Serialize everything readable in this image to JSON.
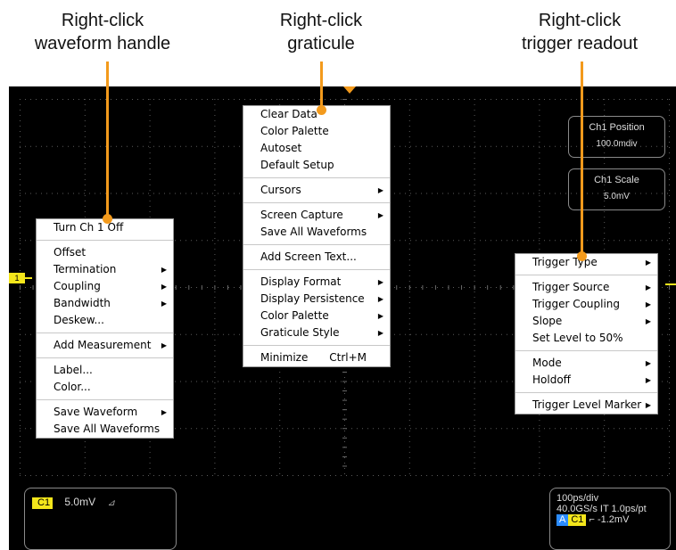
{
  "captions": [
    {
      "line1": "Right-click",
      "line2": "waveform handle"
    },
    {
      "line1": "Right-click",
      "line2": "graticule"
    },
    {
      "line1": "Right-click",
      "line2": "trigger readout"
    }
  ],
  "waveform_menu": {
    "items": [
      {
        "label": "Turn Ch 1 Off",
        "sep_after": true
      },
      {
        "label": "Offset"
      },
      {
        "label": "Termination",
        "submenu": true
      },
      {
        "label": "Coupling",
        "submenu": true
      },
      {
        "label": "Bandwidth",
        "submenu": true
      },
      {
        "label": "Deskew...",
        "sep_after": true
      },
      {
        "label": "Add Measurement",
        "submenu": true,
        "sep_after": true
      },
      {
        "label": "Label..."
      },
      {
        "label": "Color...",
        "sep_after": true
      },
      {
        "label": "Save Waveform",
        "submenu": true
      },
      {
        "label": "Save All Waveforms"
      }
    ]
  },
  "graticule_menu": {
    "items": [
      {
        "label": "Clear Data"
      },
      {
        "label": "Color Palette"
      },
      {
        "label": "Autoset"
      },
      {
        "label": "Default Setup",
        "sep_after": true
      },
      {
        "label": "Cursors",
        "submenu": true,
        "sep_after": true
      },
      {
        "label": "Screen Capture",
        "submenu": true
      },
      {
        "label": "Save All Waveforms",
        "sep_after": true
      },
      {
        "label": "Add Screen Text...",
        "sep_after": true
      },
      {
        "label": "Display Format",
        "submenu": true
      },
      {
        "label": "Display Persistence",
        "submenu": true
      },
      {
        "label": "Color Palette",
        "submenu": true
      },
      {
        "label": "Graticule Style",
        "submenu": true,
        "sep_after": true
      },
      {
        "label": "Minimize",
        "shortcut": "Ctrl+M"
      }
    ]
  },
  "trigger_menu": {
    "items": [
      {
        "label": "Trigger Type",
        "submenu": true,
        "sep_after": true
      },
      {
        "label": "Trigger Source",
        "submenu": true
      },
      {
        "label": "Trigger Coupling",
        "submenu": true
      },
      {
        "label": "Slope",
        "submenu": true
      },
      {
        "label": "Set Level to 50%",
        "sep_after": true
      },
      {
        "label": "Mode",
        "submenu": true
      },
      {
        "label": "Holdoff",
        "submenu": true,
        "sep_after": true
      },
      {
        "label": "Trigger Level Marker",
        "submenu": true
      }
    ]
  },
  "readouts": {
    "ch1_position": {
      "title": "Ch1 Position",
      "value": "100.0mdiv"
    },
    "ch1_scale": {
      "title": "Ch1 Scale",
      "value": "5.0mV"
    }
  },
  "channel_readout": {
    "badge": "C1",
    "scale": "5.0mV",
    "bandwidth_icon": "bw-limit-icon"
  },
  "timebase_readout": {
    "line1": "100ps/div",
    "line2": "40.0GS/s IT 1.0ps/pt",
    "trig_badge_a": "A",
    "trig_badge_ch": "C1",
    "trig_slope_icon": "rising-edge-icon",
    "trig_level": "-1.2mV"
  },
  "ch1_marker": "1",
  "colors": {
    "ch1": "#f4e61b",
    "trigger_marker": "#f39a1c",
    "pointer": "#f39a1c",
    "trig_source_badge": "#2b8cff"
  }
}
